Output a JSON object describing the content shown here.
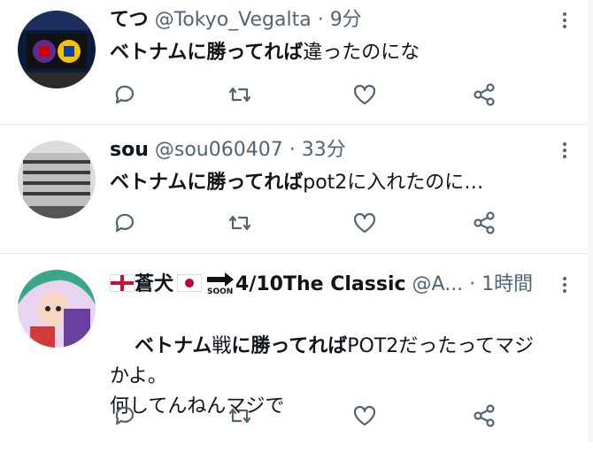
{
  "tweets": [
    {
      "name": "てつ",
      "handle": "@Tokyo_Vegalta",
      "sep": " · ",
      "time": "9分",
      "body_bold": "ベトナムに勝ってれば",
      "body_rest": "違ったのにな",
      "avatar_icon": "stadium-scoreboard-photo"
    },
    {
      "name": "sou",
      "handle": "@sou060407",
      "sep": " · ",
      "time": "33分",
      "body_bold": "ベトナムに勝ってれば",
      "body_rest": "pot2に入れたのに…",
      "avatar_icon": "building-photo"
    },
    {
      "name": "蒼犬",
      "flag_left": "england-flag-icon",
      "flag_right": "japan-flag-icon",
      "soon_label": "SOON",
      "name_rest": "4/10The Classic",
      "handle": "@A...",
      "sep": " · ",
      "time": "1時間",
      "body_part1": "ベトナム",
      "body_part2": "戦",
      "body_part3": "に勝ってれば",
      "body_rest": "POT2だったってマジかよ。",
      "body_line3": "何してんねんマジで",
      "avatar_icon": "anime-character-avatar"
    }
  ],
  "actions": [
    "reply-icon",
    "retweet-icon",
    "like-icon",
    "share-icon"
  ],
  "colors": {
    "text": "#0f1419",
    "meta": "#536471",
    "divider": "#e6e9ec"
  }
}
